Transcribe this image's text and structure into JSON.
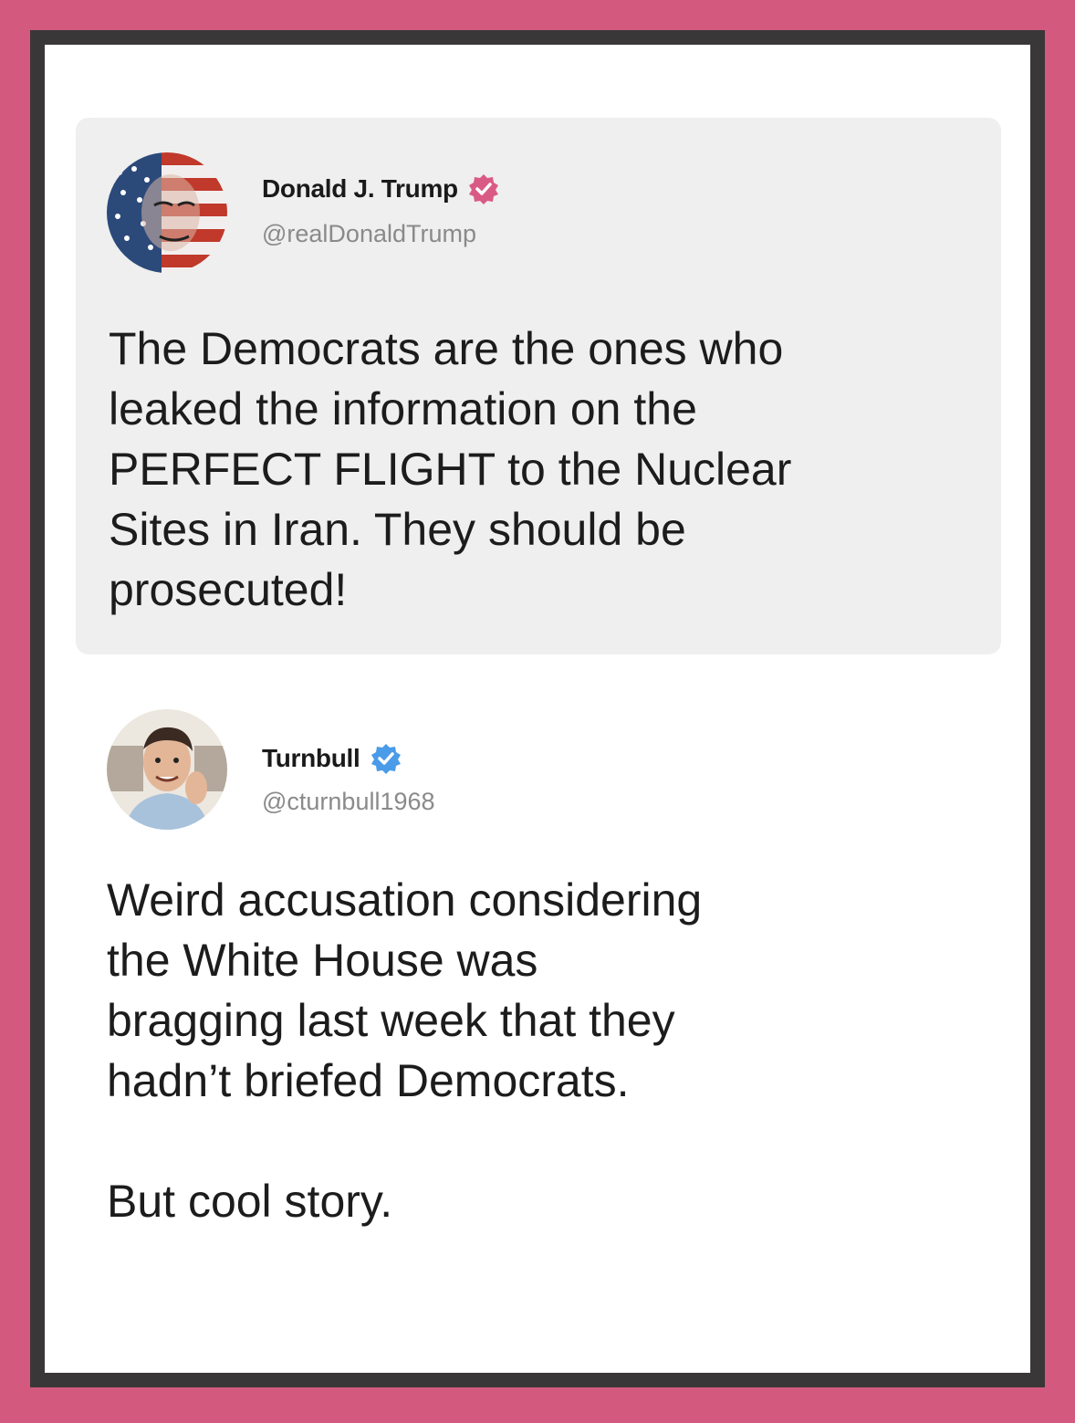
{
  "colors": {
    "outer_background": "#d35a7e",
    "frame": "#3a3739",
    "card": "#ffffff",
    "quoted_background": "#efefef",
    "trump_badge": "#d95b85",
    "turnbull_badge": "#4a9be8"
  },
  "quoted_post": {
    "name": "Donald J. Trump",
    "handle": "@realDonaldTrump",
    "badge_icon": "verified-badge-icon",
    "text": "The Democrats are the ones who\nleaked the information on the\nPERFECT FLIGHT to the Nuclear\nSites in Iran. They should be\nprosecuted!"
  },
  "reply_post": {
    "name": "Turnbull",
    "handle": "@cturnbull1968",
    "badge_icon": "verified-badge-icon",
    "text": "Weird accusation considering\nthe White House was\nbragging last week that they\nhadn’t briefed Democrats.\n\nBut cool story."
  }
}
